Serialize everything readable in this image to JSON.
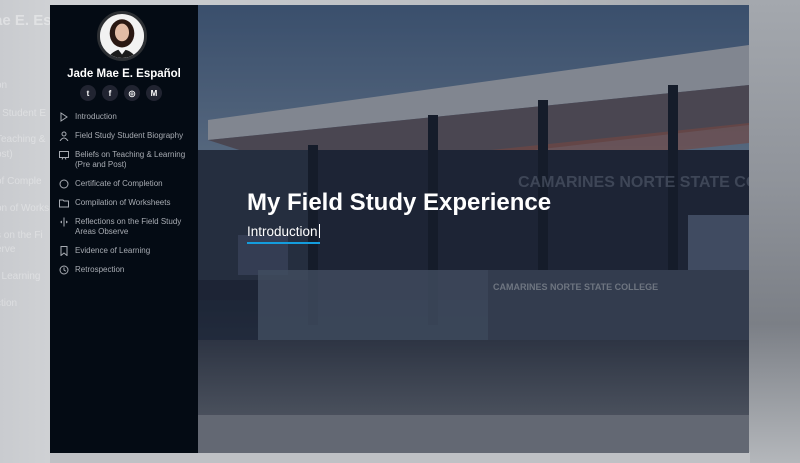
{
  "background": {
    "ghost_title": "ae E. Es",
    "ghost_items": [
      "on",
      "r Student E",
      "Teaching &",
      "ost)",
      "of Comple",
      "on of Works",
      "s on the Fi",
      "erve",
      "f Learning",
      "ction"
    ]
  },
  "sidebar": {
    "name": "Jade Mae E. Español",
    "socials": [
      {
        "icon": "twitter-icon",
        "glyph": "t"
      },
      {
        "icon": "facebook-icon",
        "glyph": "f"
      },
      {
        "icon": "instagram-icon",
        "glyph": "◎"
      },
      {
        "icon": "gmail-icon",
        "glyph": "M"
      }
    ],
    "nav": [
      {
        "icon": "play-icon",
        "label": "Introduction"
      },
      {
        "icon": "person-icon",
        "label": "Field Study Student Biography"
      },
      {
        "icon": "presentation-icon",
        "label": "Beliefs on Teaching & Learning (Pre and Post)"
      },
      {
        "icon": "circle-icon",
        "label": "Certificate of Completion"
      },
      {
        "icon": "folder-icon",
        "label": "Compilation of Worksheets"
      },
      {
        "icon": "split-arrows-icon",
        "label": "Reflections on the Field Study Areas Observe"
      },
      {
        "icon": "bookmark-icon",
        "label": "Evidence of Learning"
      },
      {
        "icon": "history-icon",
        "label": "Retrospection"
      }
    ]
  },
  "hero": {
    "title": "My Field Study Experience",
    "subtitle": "Introduction",
    "building_sign_1": "CAMARINES NORTE STATE COLLEGE",
    "building_sign_2": "CAMARINES NORTE STATE COLLEGE"
  },
  "colors": {
    "sidebar_bg": "#040b14",
    "accent": "#149ddd"
  }
}
